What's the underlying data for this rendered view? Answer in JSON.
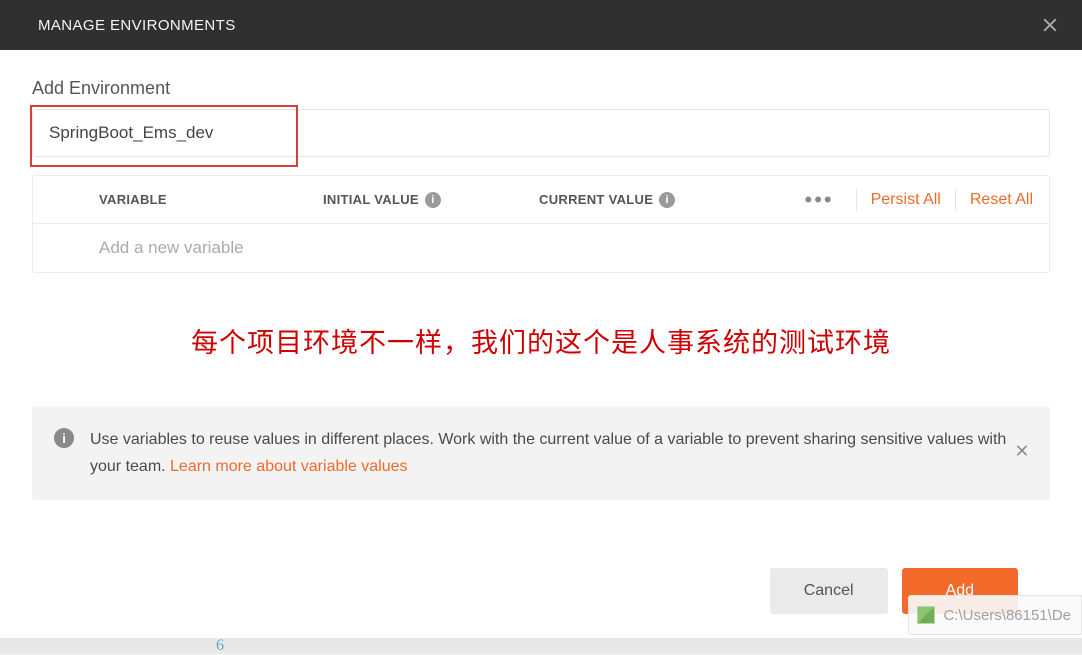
{
  "title": "MANAGE ENVIRONMENTS",
  "section_label": "Add Environment",
  "env_name_value": "SpringBoot_Ems_dev",
  "table": {
    "headers": {
      "variable": "VARIABLE",
      "initial": "INITIAL VALUE",
      "current": "CURRENT VALUE"
    },
    "actions": {
      "persist": "Persist All",
      "reset": "Reset All"
    },
    "new_row_placeholder": "Add a new variable"
  },
  "annotation": "每个项目环境不一样，我们的这个是人事系统的测试环境",
  "help": {
    "text_before_link": "Use variables to reuse values in different places. Work with the current value of a variable to prevent sharing sensitive values with your team. ",
    "link": "Learn more about variable values"
  },
  "footer": {
    "cancel": "Cancel",
    "add": "Add"
  },
  "toast_path": "C:\\Users\\86151\\De"
}
